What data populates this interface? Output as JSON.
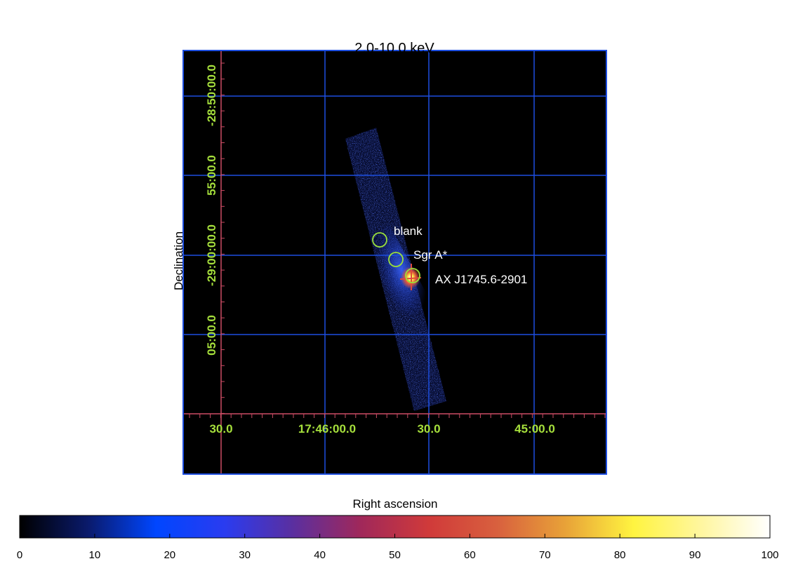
{
  "chart_data": {
    "type": "heatmap",
    "title": "2.0-10.0 keV",
    "xlabel": "Right ascension",
    "ylabel": "Declination",
    "x_tick_labels": [
      "30.0",
      "17:46:00.0",
      "30.0",
      "45:00.0"
    ],
    "y_tick_labels": [
      "-28:50:00.0",
      "55:00.0",
      "-29:00:00.0",
      "05:00.0"
    ],
    "sources": [
      {
        "name": "blank"
      },
      {
        "name": "Sgr A*"
      },
      {
        "name": "AX J1745.6-2901"
      }
    ],
    "colorbar": {
      "ticks": [
        "0",
        "10",
        "20",
        "30",
        "40",
        "50",
        "60",
        "70",
        "80",
        "90",
        "100"
      ],
      "range": [
        0,
        100
      ],
      "colors": [
        "#000000",
        "#0a1a6b",
        "#0046ff",
        "#2a3cf0",
        "#5a2fa0",
        "#a0285a",
        "#d03a3a",
        "#d8603e",
        "#e8a238",
        "#fff440",
        "#fff6a0",
        "#ffffff"
      ]
    },
    "grid": true,
    "colors": {
      "image_bg": "#000000",
      "grid": "#1d4ee0",
      "coord_axis": "#cc4c64",
      "tick_labels": "#a6e03c",
      "region_circle": "#9be03a",
      "label_text": "#ffffff"
    }
  }
}
